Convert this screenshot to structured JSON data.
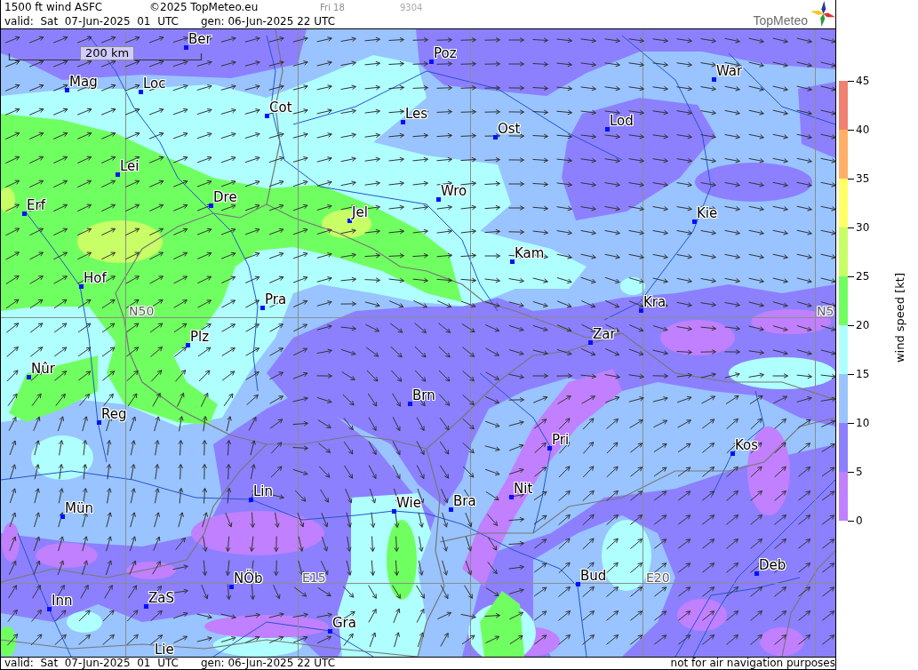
{
  "header": {
    "title": "1500 ft wind ASFC",
    "copyright": "©2025 TopMeteo.eu",
    "run_label": "Fri 18",
    "code": "9304",
    "valid": "valid:  Sat  07-Jun-2025  01  UTC",
    "generated": "gen: 06-Jun-2025 22 UTC",
    "logo_text": "TopMeteo"
  },
  "map": {
    "scale_label": "200 km",
    "grid_labels": [
      "N50",
      "N5",
      "E15",
      "E20"
    ],
    "cities": [
      "Ber",
      "Poz",
      "War",
      "Mag",
      "Loc",
      "Cot",
      "Les",
      "Lod",
      "Ost",
      "Lei",
      "Wro",
      "Dre",
      "Erf",
      "Jel",
      "Kie",
      "Kam",
      "Hof",
      "Pra",
      "Kra",
      "Zar",
      "Plz",
      "Nûr",
      "Brn",
      "Reg",
      "Pri",
      "Kos",
      "Nit",
      "Lin",
      "Bra",
      "Wie",
      "Mün",
      "Deb",
      "Bud",
      "NÖb",
      "ZaS",
      "Inn",
      "Gra",
      "Lie"
    ]
  },
  "legend": {
    "ticks": [
      "45",
      "40",
      "35",
      "30",
      "25",
      "20",
      "15",
      "10",
      "5",
      "0"
    ],
    "bands": [
      {
        "color": "#f08070"
      },
      {
        "color": "#ffb066"
      },
      {
        "color": "#ffff66"
      },
      {
        "color": "#c8ff66"
      },
      {
        "color": "#70ff60"
      },
      {
        "color": "#b0ffff"
      },
      {
        "color": "#99c4ff"
      },
      {
        "color": "#8c80ff"
      },
      {
        "color": "#c080ff"
      }
    ],
    "title": "wind speed [kt]"
  },
  "footer": {
    "valid": "valid:  Sat  07-Jun-2025  01  UTC",
    "generated": "gen: 06-Jun-2025 22 UTC",
    "disclaimer": "not for air navigation purposes"
  }
}
